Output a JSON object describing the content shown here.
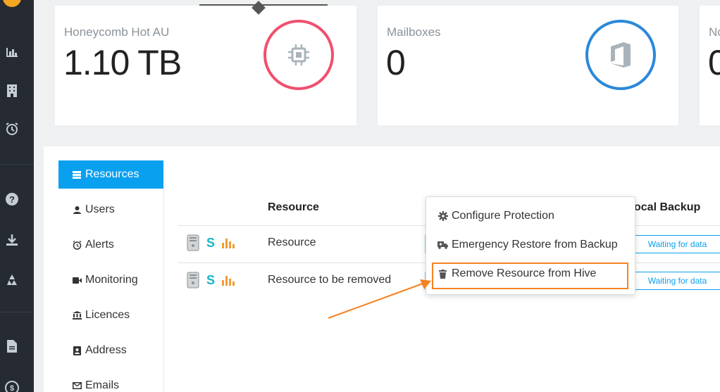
{
  "cards": [
    {
      "label": "Honeycomb Hot AU",
      "value": "1.10 TB",
      "icon": "chip-icon",
      "color": "#f0506e"
    },
    {
      "label": "Mailboxes",
      "value": "0",
      "icon": "office-icon",
      "color": "#2b88d8"
    },
    {
      "label": "No",
      "value": "0"
    }
  ],
  "subnav": [
    {
      "label": "Resources",
      "icon": "list-icon",
      "active": true
    },
    {
      "label": "Users",
      "icon": "user-icon"
    },
    {
      "label": "Alerts",
      "icon": "alarm-icon"
    },
    {
      "label": "Monitoring",
      "icon": "video-icon"
    },
    {
      "label": "Licences",
      "icon": "bank-icon"
    },
    {
      "label": "Address",
      "icon": "contact-card-icon"
    },
    {
      "label": "Emails",
      "icon": "envelope-icon"
    }
  ],
  "table": {
    "headers": {
      "resource": "Resource",
      "local_backup": "ocal Backup"
    },
    "rows": [
      {
        "name": "Resource",
        "status": "Waiting for data"
      },
      {
        "name": "Resource to be removed",
        "status": "Waiting for data"
      }
    ]
  },
  "menu": {
    "items": [
      {
        "label": "Configure Protection",
        "icon": "gear-icon"
      },
      {
        "label": "Emergency Restore from Backup",
        "icon": "ambulance-icon"
      },
      {
        "label": "Remove Resource from Hive",
        "icon": "trash-icon",
        "highlighted": true
      }
    ]
  },
  "colors": {
    "accent": "#0aa0f0",
    "annotation": "#f58220",
    "rail": "#252a33"
  }
}
